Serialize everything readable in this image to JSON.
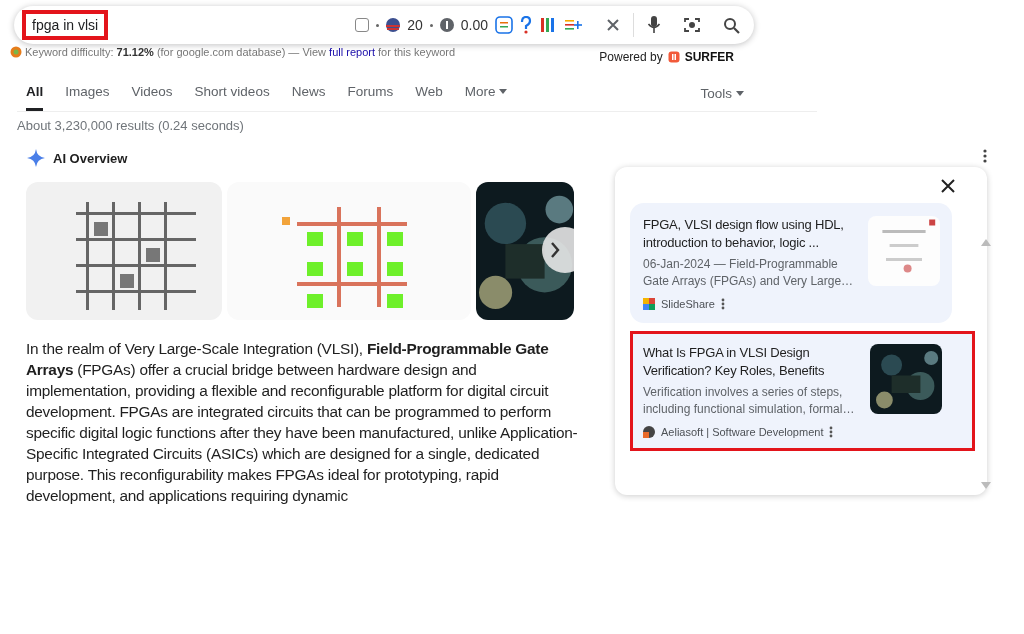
{
  "search": {
    "query": "fpga in vlsi",
    "highlighted": true,
    "checkbox_checked": false,
    "rank": "20",
    "cost": "0.00"
  },
  "keyword_bar": {
    "sentence": "Keyword difficulty: **71.12%** (for google.com database) — View",
    "link": "full report",
    "after": "for this keyword"
  },
  "powered_by": {
    "label": "Powered by",
    "brand": "SURFER"
  },
  "tabs": [
    {
      "label": "All",
      "selected": true,
      "kind": "tab"
    },
    {
      "label": "Images",
      "selected": false,
      "kind": "tab"
    },
    {
      "label": "Videos",
      "selected": false,
      "kind": "tab"
    },
    {
      "label": "Short videos",
      "selected": false,
      "kind": "tab"
    },
    {
      "label": "News",
      "selected": false,
      "kind": "tab"
    },
    {
      "label": "Forums",
      "selected": false,
      "kind": "tab"
    },
    {
      "label": "Web",
      "selected": false,
      "kind": "tab"
    },
    {
      "label": "More",
      "selected": false,
      "kind": "dropdown"
    }
  ],
  "tools": "Tools",
  "result_stats": "About 3,230,000 results (0.24 seconds)",
  "ai_overview": {
    "title": "AI Overview",
    "paragraph": "In the realm of Very Large-Scale Integration (VLSI), **Field-Programmable Gate Arrays** (FPGAs) offer a crucial bridge between hardware design and implementation, providing a flexible and reconfigurable platform for digital circuit development. FPGAs are integrated circuits that can be programmed to perform specific digital logic functions after they have been manufactured, unlike Application-Specific Integrated Circuits (ASICs) which are designed for a single, dedicated purpose. This reconfigurability makes FPGAs ideal for prototyping, rapid development, and applications requiring dynamic"
  },
  "sources": [
    {
      "title": "FPGA, VLSI design flow using HDL, introduction to behavior, logic ...",
      "snippet": "06-Jan-2024 — Field-Programmable Gate Arrays (FPGAs) and Very Large…",
      "source": "SlideShare",
      "highlighted": false
    },
    {
      "title": "What Is FPGA in VLSI Design Verification? Key Roles, Benefits",
      "snippet": "Verification involves a series of steps, including functional simulation, formal…",
      "source": "Aeliasoft | Software Development",
      "highlighted": true
    }
  ]
}
